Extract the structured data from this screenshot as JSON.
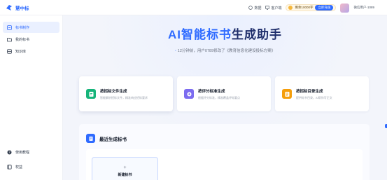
{
  "app": {
    "brand_name": "慧中标"
  },
  "topbar": {
    "data_label": "数据",
    "customer_label": "客户端",
    "balance_text": "剩余10000字",
    "recharge_label": "立即充值",
    "user_name": "微信用户-1089"
  },
  "sidebar": {
    "items": [
      {
        "label": "标书制作",
        "icon": "document-edit-icon",
        "active": true
      },
      {
        "label": "我的标书",
        "icon": "folder-icon",
        "active": false
      },
      {
        "label": "知识库",
        "icon": "database-icon",
        "active": false
      }
    ],
    "bottom": [
      {
        "label": "使用教程",
        "icon": "help-circle-icon"
      },
      {
        "label": "权益",
        "icon": "crown-icon"
      }
    ]
  },
  "hero": {
    "title_prefix": "AI智能标书",
    "title_suffix": "生成助手",
    "activity": "12分钟前，用户0789修改了《教育信息化建设投标方案》"
  },
  "cards": [
    {
      "title": "按招标文件生成",
      "desc": "智能解析招标文件，精准响应招标要求",
      "icon": "file-upload-icon",
      "color": "#16b47a"
    },
    {
      "title": "按评分标准生成",
      "desc": "根据评分标准，精准覆盖评标要点",
      "icon": "score-icon",
      "color": "#7c6cf0"
    },
    {
      "title": "按招标目录生成",
      "desc": "提供标书目录，AI帮你写正文",
      "icon": "outline-icon",
      "color": "#f59e0b"
    }
  ],
  "recent": {
    "title": "最近生成标书",
    "new_label": "新建标书",
    "plus": "+"
  },
  "colors": {
    "accent": "#2f6bff",
    "title_dark": "#1f2e6b"
  }
}
